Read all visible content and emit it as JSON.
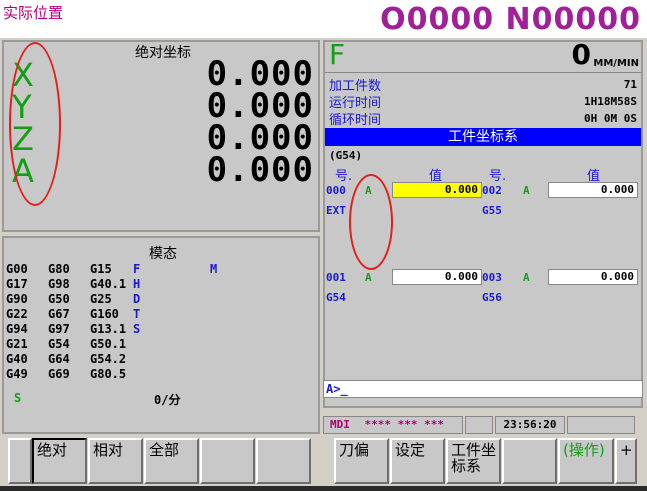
{
  "header": {
    "screen_title": "实际位置",
    "program_number": "O0000 N00000"
  },
  "absolute_position": {
    "title": "绝对坐标",
    "axes": [
      {
        "name": "X",
        "value": "0.000"
      },
      {
        "name": "Y",
        "value": "0.000"
      },
      {
        "name": "Z",
        "value": "0.000"
      },
      {
        "name": "A",
        "value": "0.000"
      }
    ]
  },
  "modal": {
    "title": "模态",
    "rows": [
      [
        "G00",
        "G80",
        "G15",
        "F",
        "",
        "M"
      ],
      [
        "G17",
        "G98",
        "G40.1",
        "H",
        "",
        ""
      ],
      [
        "G90",
        "G50",
        "G25",
        "D",
        "",
        ""
      ],
      [
        "G22",
        "G67",
        "G160",
        "T",
        "",
        ""
      ],
      [
        "G94",
        "G97",
        "G13.1",
        "S",
        "",
        ""
      ],
      [
        "G21",
        "G54",
        "G50.1",
        "",
        "",
        ""
      ],
      [
        "G40",
        "G64",
        "G54.2",
        "",
        "",
        ""
      ],
      [
        "G49",
        "G69",
        "G80.5",
        "",
        "",
        ""
      ]
    ],
    "s_label": "S",
    "spindle_unit": "0/分"
  },
  "feed": {
    "label": "F",
    "value": "0",
    "unit": "MM/MIN"
  },
  "info": [
    {
      "label": "加工件数",
      "value": "71"
    },
    {
      "label": "运行时间",
      "value": "1H18M58S"
    },
    {
      "label": "循环时间",
      "value": "0H 0M 0S"
    }
  ],
  "work_coords": {
    "title": "工件坐标系",
    "current": "(G54)",
    "col_no": "号.",
    "col_value": "值",
    "entries": [
      {
        "no": "000",
        "axis": "A",
        "value": "0.000",
        "code": "EXT",
        "highlight": true
      },
      {
        "no": "002",
        "axis": "A",
        "value": "0.000",
        "code": "G55",
        "highlight": false
      },
      {
        "no": "001",
        "axis": "A",
        "value": "0.000",
        "code": "G54",
        "highlight": false
      },
      {
        "no": "003",
        "axis": "A",
        "value": "0.000",
        "code": "G56",
        "highlight": false
      }
    ]
  },
  "input_prompt": "A>_",
  "status": {
    "mode": "MDI",
    "flags": "**** *** ***",
    "time": "23:56:20"
  },
  "softkeys": {
    "left": [
      "绝对",
      "相对",
      "全部",
      "",
      ""
    ],
    "right": [
      "刀偏",
      "设定",
      "工件坐标系",
      "",
      "(操作)"
    ],
    "next": "+"
  },
  "colors": {
    "axis_green": "#12a012",
    "program_magenta": "#a0209a",
    "header_blue": "#0000ff",
    "highlight_yellow": "#ffff00",
    "annotation_red": "#e0201a"
  }
}
